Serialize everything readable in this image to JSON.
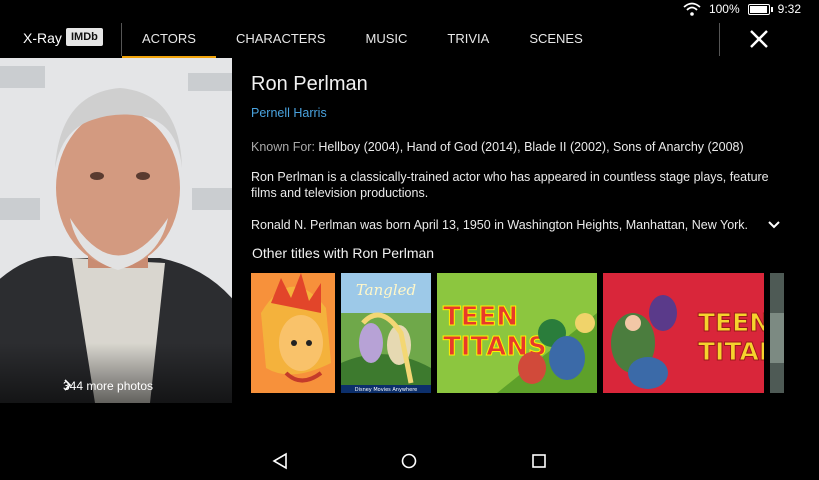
{
  "status": {
    "battery_text": "100%",
    "battery_level": 1.0,
    "time": "9:32"
  },
  "header": {
    "xray_label": "X-Ray",
    "imdb_label": "IMDb",
    "tabs": [
      {
        "label": "ACTORS",
        "active": true
      },
      {
        "label": "CHARACTERS",
        "active": false
      },
      {
        "label": "MUSIC",
        "active": false
      },
      {
        "label": "TRIVIA",
        "active": false
      },
      {
        "label": "SCENES",
        "active": false
      }
    ],
    "accent_color": "#f0a30a"
  },
  "photo": {
    "more_label": "344 more photos"
  },
  "actor": {
    "name": "Ron Perlman",
    "character": "Pernell Harris",
    "known_for_label": "Known For:",
    "known_for": "Hellboy (2004), Hand of God (2014), Blade II (2002), Sons of Anarchy (2008)",
    "bio_1": "Ron Perlman is a classically-trained actor who has appeared in countless stage plays, feature films and television productions.",
    "bio_2": "Ronald N. Perlman was born April 13, 1950 in Washington Heights, Manhattan, New York.",
    "link_color": "#4aa3df"
  },
  "other_titles": {
    "heading": "Other titles with Ron Perlman",
    "items": [
      {
        "title_art": ""
      },
      {
        "title_art": "Tangled",
        "caption": "Disney Movies Anywhere"
      },
      {
        "title_art": "TEEN TITANS"
      },
      {
        "title_art": "TEEN TITANS"
      },
      {
        "title_art": ""
      }
    ]
  }
}
